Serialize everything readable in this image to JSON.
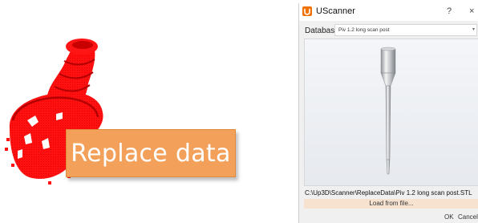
{
  "illustration": {
    "callout_text": "Replace data",
    "callout_color": "#f3a05a",
    "scan_color": "#ff1010"
  },
  "dialog": {
    "title": "UScanner",
    "help_label": "?",
    "close_label": "×",
    "database_label": "Database",
    "database_value": "Piv 1.2 long scan post",
    "stl_path": "C:\\Up3D\\Scanner\\ReplaceData\\Piv 1.2 long scan post.STL",
    "load_button": "Load from file...",
    "ok_button": "OK",
    "cancel_button": "Cancel",
    "accent_color": "#f0730a",
    "icons": [
      "uscanner-logo-icon",
      "chevron-down-icon"
    ]
  }
}
